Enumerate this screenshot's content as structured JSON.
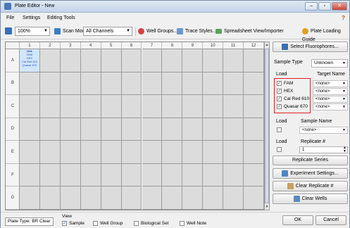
{
  "window": {
    "title": "Plate Editor - New",
    "controls": [
      "–",
      "▫",
      "✕"
    ]
  },
  "menu": {
    "items": [
      "File",
      "Settings",
      "Editing Tools"
    ],
    "help": "?"
  },
  "toolbar": {
    "zoom": "100%",
    "scan_mode_label": "Scan Mode",
    "scan_mode_value": "All Channels",
    "well_groups": "Well Groups...",
    "trace_styles": "Trace Styles...",
    "spreadsheet": "Spreadsheet View/Importer",
    "plate_loading_guide": "Plate Loading Guide"
  },
  "grid": {
    "columns": [
      "1",
      "2",
      "3",
      "4",
      "5",
      "6",
      "7",
      "8",
      "9",
      "10",
      "11",
      "12"
    ],
    "rows": [
      "A",
      "B",
      "C",
      "D",
      "E",
      "F",
      "G"
    ],
    "selected_cell": {
      "row": "A",
      "col": "1",
      "lines": [
        "Unk",
        "FAM",
        "HEX",
        "Cal Red 610",
        "Quasar 670"
      ]
    }
  },
  "panel": {
    "select_fluorophores": "Select Fluorophores...",
    "sample_type_label": "Sample Type",
    "sample_type_value": "Unknown",
    "load_label": "Load",
    "target_name_label": "Target Name",
    "targets": [
      {
        "name": "FAM",
        "target": "<none>",
        "checked": true
      },
      {
        "name": "HEX",
        "target": "<none>",
        "checked": true
      },
      {
        "name": "Cal Red 610",
        "target": "<none>",
        "checked": true
      },
      {
        "name": "Quasar 670",
        "target": "<none>",
        "checked": true
      }
    ],
    "sample_name_label": "Sample Name",
    "sample_name_value": "<none>",
    "replicate_label": "Replicate #",
    "replicate_value": "1",
    "replicate_series": "Replicate Series",
    "experiment_settings": "Experiment Settings...",
    "clear_replicate": "Clear Replicate #",
    "clear_wells": "Clear Wells"
  },
  "status": {
    "plate_type": "Plate Type: BR Clear",
    "view_label": "View",
    "view_items": [
      {
        "label": "Sample",
        "checked": true
      },
      {
        "label": "Well Group",
        "checked": false
      },
      {
        "label": "Biological Set",
        "checked": false
      },
      {
        "label": "Well Note",
        "checked": false
      }
    ],
    "ok": "OK",
    "cancel": "Cancel"
  },
  "colors": {
    "accent": "#4a78b8",
    "selected_well": "#cfe6fb",
    "empty_well": "#dcdcdc",
    "highlight_box": "#e02020"
  }
}
